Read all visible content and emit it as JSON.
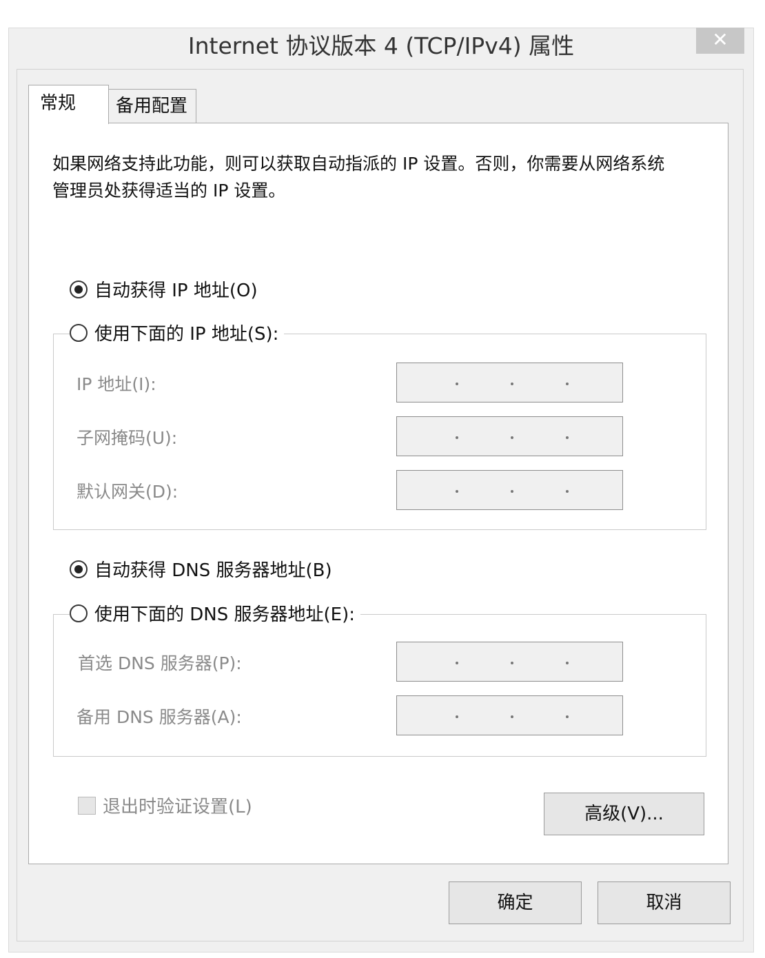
{
  "window": {
    "title": "Internet 协议版本 4 (TCP/IPv4) 属性",
    "close_glyph": "✕"
  },
  "tabs": [
    {
      "label": "常规",
      "active": true
    },
    {
      "label": "备用配置",
      "active": false
    }
  ],
  "description": "如果网络支持此功能，则可以获取自动指派的 IP 设置。否则，你需要从网络系统管理员处获得适当的 IP 设置。",
  "ip": {
    "auto_label": "自动获得 IP 地址(O)",
    "auto_checked": true,
    "manual_label": "使用下面的 IP 地址(S):",
    "manual_checked": false,
    "fields": [
      {
        "label": "IP 地址(I):",
        "value": ""
      },
      {
        "label": "子网掩码(U):",
        "value": ""
      },
      {
        "label": "默认网关(D):",
        "value": ""
      }
    ]
  },
  "dns": {
    "auto_label": "自动获得 DNS 服务器地址(B)",
    "auto_checked": true,
    "manual_label": "使用下面的 DNS 服务器地址(E):",
    "manual_checked": false,
    "fields": [
      {
        "label": "首选 DNS 服务器(P):",
        "value": ""
      },
      {
        "label": "备用 DNS 服务器(A):",
        "value": ""
      }
    ]
  },
  "validate_on_exit": {
    "label": "退出时验证设置(L)",
    "checked": false
  },
  "buttons": {
    "advanced": "高级(V)...",
    "ok": "确定",
    "cancel": "取消"
  }
}
